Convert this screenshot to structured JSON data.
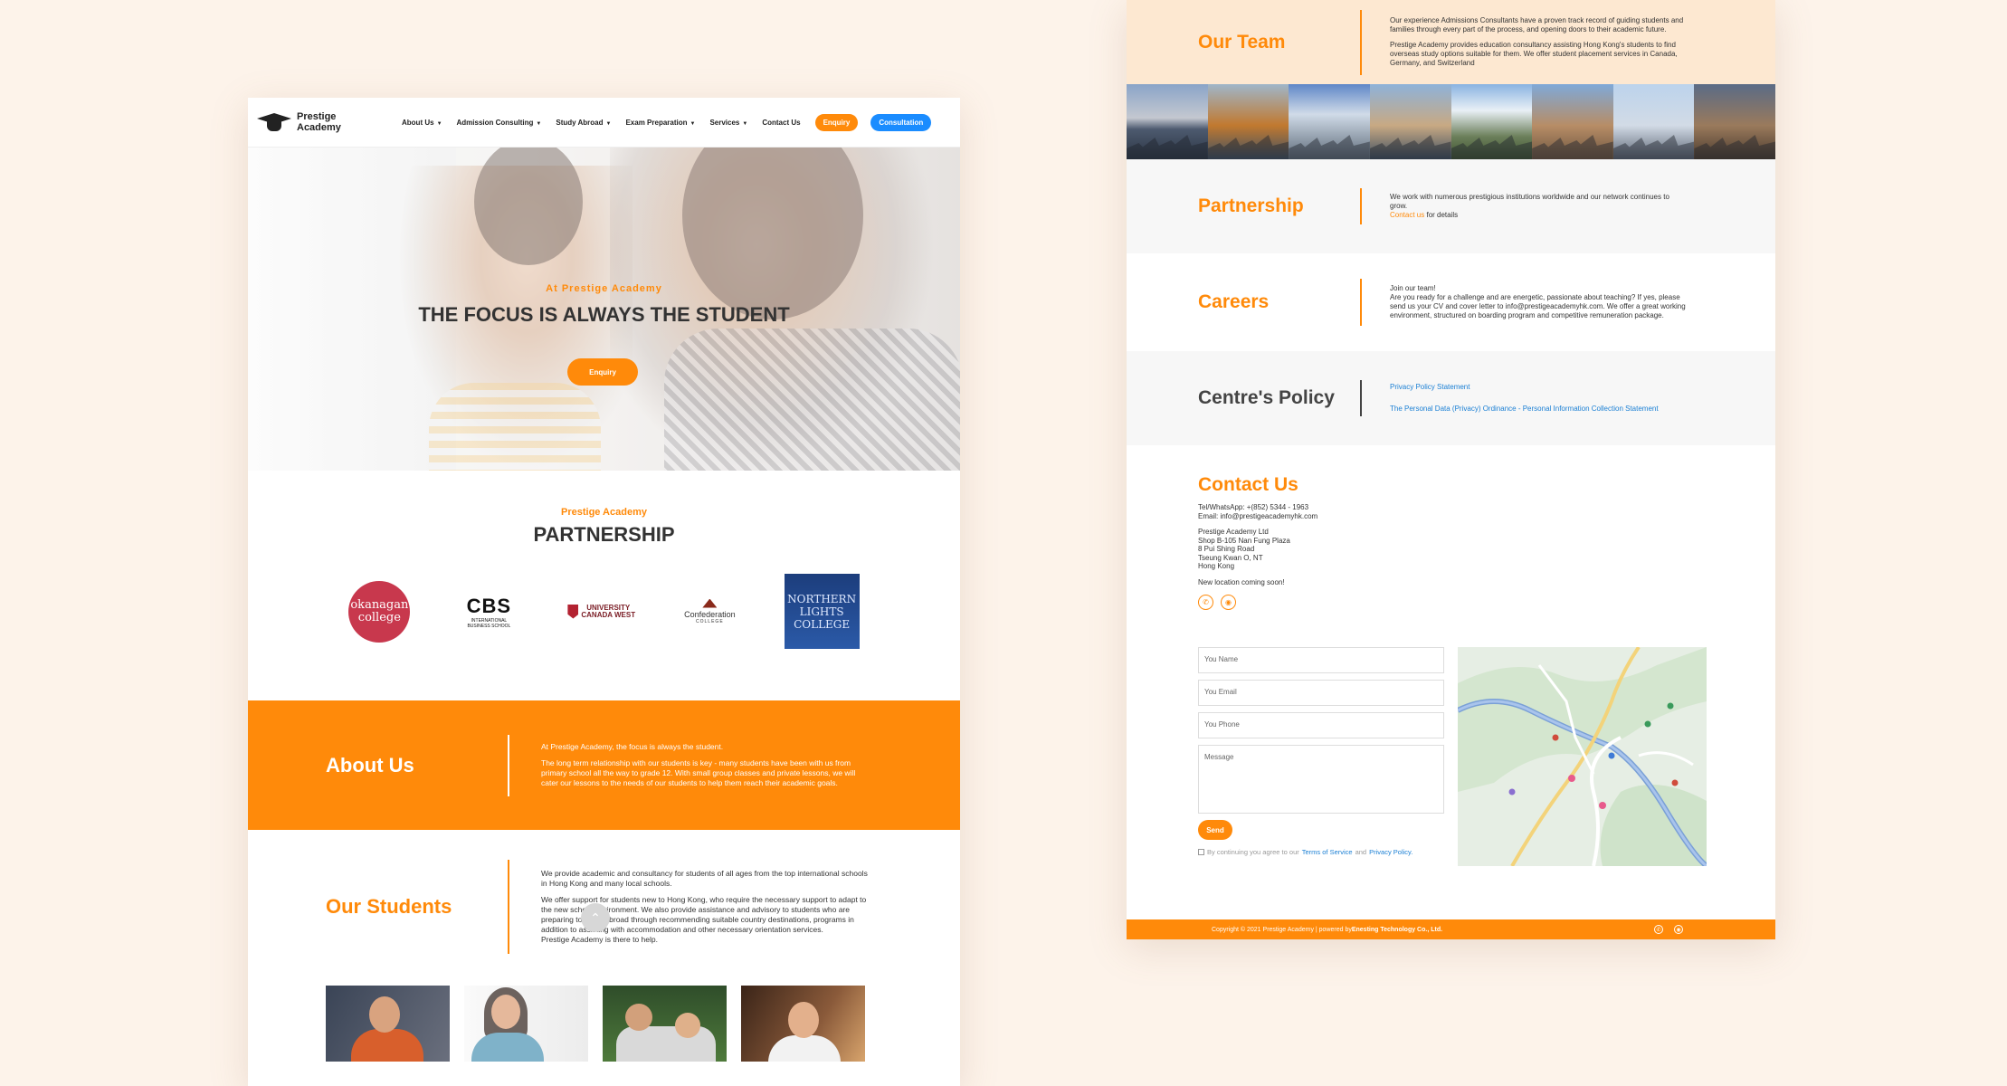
{
  "left": {
    "nav": {
      "logo_line1": "Prestige",
      "logo_line2": "Academy",
      "items": [
        "About Us",
        "Admission Consulting",
        "Study Abroad",
        "Exam Preparation",
        "Services",
        "Contact Us"
      ],
      "enquiry": "Enquiry",
      "consultation": "Consultation"
    },
    "hero": {
      "subtitle": "At Prestige Academy",
      "title": "THE FOCUS IS ALWAYS THE STUDENT",
      "button": "Enquiry"
    },
    "partnership": {
      "subtitle": "Prestige Academy",
      "title": "PARTNERSHIP",
      "logos": {
        "okanagan_1": "okanagan",
        "okanagan_2": "college",
        "cbs_main": "CBS",
        "cbs_sub": "INTERNATIONAL BUSINESS SCHOOL",
        "ucw_1": "UNIVERSITY",
        "ucw_2": "CANADA WEST",
        "conf_main": "Confederation",
        "conf_sub": "COLLEGE",
        "nlc_1": "NORTHERN",
        "nlc_2": "LIGHTS",
        "nlc_3": "COLLEGE"
      }
    },
    "about": {
      "title": "About Us",
      "p1": "At Prestige Academy, the focus is always the student.",
      "p2": "The long term relationship with our students is key - many students have been with us from primary school all the way to grade 12. With small group classes and private lessons, we will cater our lessons to the needs of our students to help them reach their academic goals."
    },
    "students": {
      "title": "Our Students",
      "p1": "We provide academic and consultancy for students of all ages from the top international schools in Hong Kong and many local schools.",
      "p2": "We offer support for students new to Hong Kong, who require the necessary support to adapt to the new school environment. We also provide assistance and advisory to students who are preparing to study abroad through recommending suitable country destinations, programs in addition to assisting with accommodation and other necessary orientation services.",
      "p3": "Prestige Academy is there to help."
    }
  },
  "right": {
    "team": {
      "title": "Our Team",
      "p1": "Our experience Admissions Consultants have a proven track record of guiding students and families through every part of the process, and opening doors to their academic future.",
      "p2": "Prestige Academy provides education consultancy assisting Hong Kong's students to find overseas study options suitable for them. We offer student placement services in Canada, Germany, and Switzerland"
    },
    "partnership": {
      "title": "Partnership",
      "text": "We work with numerous prestigious institutions worldwide and our network continues to grow.",
      "link": "Contact us",
      "link_tail": " for details"
    },
    "careers": {
      "title": "Careers",
      "line1": "Join our team!",
      "text": "Are you ready for a challenge and are energetic, passionate about teaching? If yes, please send us your CV and cover letter to info@prestigeacademyhk.com. We offer a great working environment, structured on boarding program and competitive remuneration package."
    },
    "policy": {
      "title": "Centre's Policy",
      "link1": "Privacy Policy Statement",
      "link2": "The Personal Data (Privacy) Ordinance - Personal Information Collection Statement"
    },
    "contact": {
      "title": "Contact Us",
      "tel": "Tel/WhatsApp: +(852) 5344 - 1963",
      "email": "Email: info@prestigeacademyhk.com",
      "addr1": "Prestige Academy Ltd",
      "addr2": "Shop B-105 Nan Fung Plaza",
      "addr3": "8 Pui Shing Road",
      "addr4": "Tseung Kwan O, NT",
      "addr5": "Hong Kong",
      "note": "New location coming soon!",
      "form": {
        "name_ph": "You Name",
        "email_ph": "You Email",
        "phone_ph": "You Phone",
        "message_ph": "Message",
        "send": "Send",
        "agree_pre": "By continuing you agree to our ",
        "terms": "Terms of Service",
        "and": " and ",
        "privacy": "Privacy Policy."
      }
    },
    "footer": {
      "text_pre": "Copyright © 2021 Prestige Academy | powered by ",
      "text_brand": "Enesting Technology Co., Ltd."
    }
  }
}
